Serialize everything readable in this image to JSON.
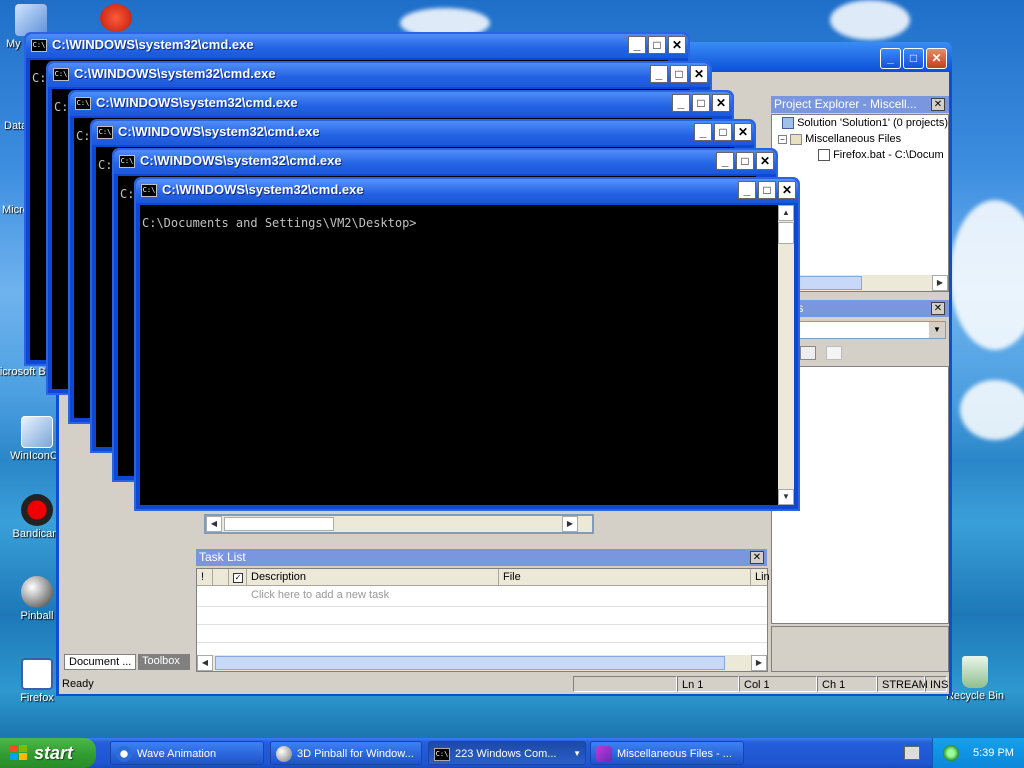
{
  "desktop_icons": [
    {
      "label": "My",
      "icon": "computer-icon"
    },
    {
      "label": "Data",
      "icon": "folder-icon"
    },
    {
      "label": "Micros",
      "icon": "app-icon"
    },
    {
      "label": "Microsoft Basic",
      "icon": "app-icon"
    },
    {
      "label": "WinIconCu",
      "icon": "image-icon"
    },
    {
      "label": "Bandicam",
      "icon": "record-icon"
    },
    {
      "label": "Pinball",
      "icon": "pinball-icon"
    },
    {
      "label": "Firefox",
      "icon": "batch-file-icon"
    },
    {
      "label": "Recycle Bin",
      "icon": "recycle-bin-icon"
    }
  ],
  "cmd_windows": [
    {
      "title": "C:\\WINDOWS\\system32\\cmd.exe",
      "first_char": "C:"
    },
    {
      "title": "C:\\WINDOWS\\system32\\cmd.exe",
      "first_char": "C:"
    },
    {
      "title": "C:\\WINDOWS\\system32\\cmd.exe",
      "first_char": "C:"
    },
    {
      "title": "C:\\WINDOWS\\system32\\cmd.exe",
      "first_char": "C:"
    },
    {
      "title": "C:\\WINDOWS\\system32\\cmd.exe",
      "first_char": "C:"
    },
    {
      "title": "C:\\WINDOWS\\system32\\cmd.exe",
      "prompt": "C:\\Documents and Settings\\VM2\\Desktop>"
    }
  ],
  "cmd_icon_text": "C:\\",
  "vs": {
    "project_explorer": {
      "title": "Project Explorer - Miscell...",
      "items": [
        "Solution 'Solution1' (0 projects)",
        "Miscellaneous Files",
        "Firefox.bat - C:\\Docum"
      ]
    },
    "properties": {
      "title": "erties"
    },
    "task_list": {
      "title": "Task List",
      "columns": [
        "!",
        "",
        "Description",
        "File",
        "Lin"
      ],
      "placeholder": "Click here to add a new task"
    },
    "tabs": [
      "Document ...",
      "Toolbox"
    ],
    "status": {
      "ready": "Ready",
      "ln": "Ln 1",
      "col": "Col 1",
      "ch": "Ch 1",
      "stream": "STREAM",
      "ins": "INS"
    }
  },
  "taskbar": {
    "start": "start",
    "buttons": [
      "Wave Animation",
      "3D Pinball for Window...",
      "223 Windows Com...",
      "Miscellaneous Files - ..."
    ],
    "clock": "5:39 PM"
  }
}
